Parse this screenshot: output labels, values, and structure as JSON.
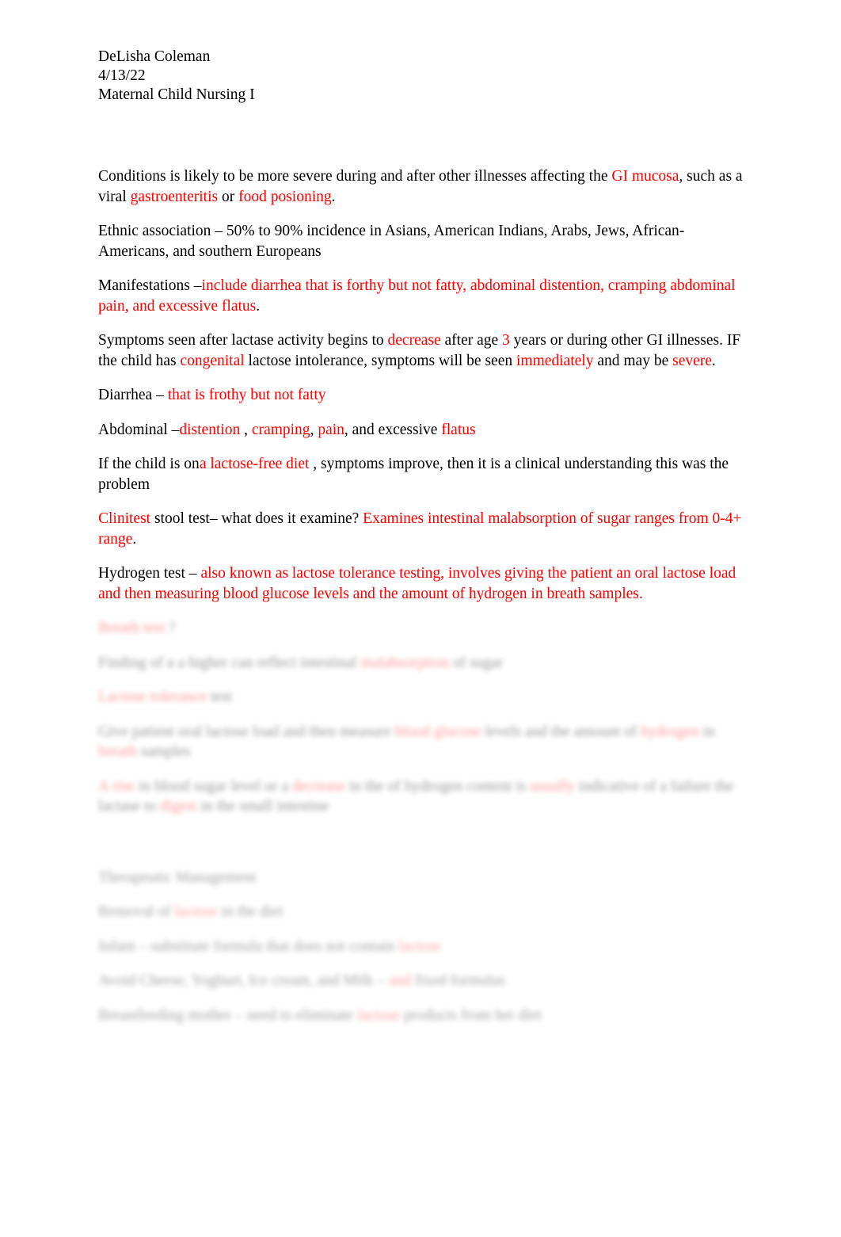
{
  "document": {
    "header": {
      "author": "DeLisha Coleman",
      "date": "4/13/22",
      "course": "Maternal Child Nursing I"
    },
    "colors": {
      "accent_red": "#ff0000",
      "body_black": "#000000",
      "page_background": "#ffffff"
    },
    "paragraphs": [
      {
        "id": "conditions",
        "runs": [
          {
            "text": "Conditions is likely to be more severe during and after other illnesses affecting the  ",
            "color": "black"
          },
          {
            "text": "GI mucosa",
            "color": "red"
          },
          {
            "text": ", such as a viral ",
            "color": "black"
          },
          {
            "text": "gastroenteritis",
            "color": "red"
          },
          {
            "text": "  or  ",
            "color": "black"
          },
          {
            "text": "food posioning",
            "color": "red"
          },
          {
            "text": ".",
            "color": "black"
          }
        ]
      },
      {
        "id": "ethnic-association",
        "runs": [
          {
            "text": "Ethnic association – 50% to 90% incidence in Asians, American Indians, Arabs, Jews, African-Americans, and southern Europeans",
            "color": "black"
          }
        ]
      },
      {
        "id": "manifestations",
        "runs": [
          {
            "text": "Manifestations –",
            "color": "black"
          },
          {
            "text": "include diarrhea that is forthy but not fatty, abdominal distention, cramping abdominal pain, and excessive flatus",
            "color": "red"
          },
          {
            "text": ".",
            "color": "black"
          }
        ]
      },
      {
        "id": "symptoms-onset",
        "runs": [
          {
            "text": "Symptoms seen after lactase activity begins to  ",
            "color": "black"
          },
          {
            "text": "decrease",
            "color": "red"
          },
          {
            "text": "  after age  ",
            "color": "black"
          },
          {
            "text": "3",
            "color": "red"
          },
          {
            "text": " years or during other GI illnesses.  IF the child has ",
            "color": "black"
          },
          {
            "text": "congenital",
            "color": "red"
          },
          {
            "text": "  lactose intolerance, symptoms will be seen  ",
            "color": "black"
          },
          {
            "text": "immediately",
            "color": "red"
          },
          {
            "text": " and may be ",
            "color": "black"
          },
          {
            "text": "severe",
            "color": "red"
          },
          {
            "text": ".",
            "color": "black"
          }
        ]
      },
      {
        "id": "diarrhea",
        "runs": [
          {
            "text": "Diarrhea – ",
            "color": "black"
          },
          {
            "text": "that is frothy but not fatty",
            "color": "red"
          }
        ]
      },
      {
        "id": "abdominal",
        "runs": [
          {
            "text": "Abdominal –",
            "color": "black"
          },
          {
            "text": "distention",
            "color": "red"
          },
          {
            "text": " , ",
            "color": "black"
          },
          {
            "text": "cramping",
            "color": "red"
          },
          {
            "text": ", ",
            "color": "black"
          },
          {
            "text": "pain",
            "color": "red"
          },
          {
            "text": ", and excessive ",
            "color": "black"
          },
          {
            "text": "flatus",
            "color": "red"
          }
        ]
      },
      {
        "id": "lactose-free-diet",
        "runs": [
          {
            "text": "If the child is on",
            "color": "black"
          },
          {
            "text": "a lactose-free diet",
            "color": "red"
          },
          {
            "text": " , symptoms improve, then it is a clinical understanding this was the problem",
            "color": "black"
          }
        ]
      },
      {
        "id": "clinitest",
        "runs": [
          {
            "text": "Clinitest",
            "color": "red"
          },
          {
            "text": " stool test– what does it examine?  ",
            "color": "black"
          },
          {
            "text": "Examines intestinal malabsorption of sugar  ranges from 0-4+ range",
            "color": "red"
          },
          {
            "text": ".",
            "color": "black"
          }
        ]
      },
      {
        "id": "hydrogen-test",
        "runs": [
          {
            "text": "Hydrogen test – ",
            "color": "black"
          },
          {
            "text": "also known as lactose tolerance testing, involves giving the patient an oral lactose load and then measuring blood glucose levels and the amount of hydrogen in breath samples.",
            "color": "red"
          }
        ]
      }
    ],
    "obscured_section": {
      "note": "remaining lines are visually blurred and illegible in the source image",
      "blocks": [
        {
          "id": "obscured-1",
          "runs": [
            {
              "text": "Breath test",
              "color": "red"
            },
            {
              "text": "  ?",
              "color": "black"
            }
          ]
        },
        {
          "id": "obscured-2",
          "runs": [
            {
              "text": "Finding  of a  a higher can reflect intestinal ",
              "color": "black"
            },
            {
              "text": "malabsorption",
              "color": "red"
            },
            {
              "text": " of sugar",
              "color": "black"
            }
          ]
        },
        {
          "id": "obscured-3",
          "runs": [
            {
              "text": "Lactose tolerance",
              "color": "red"
            },
            {
              "text": " test",
              "color": "black"
            }
          ]
        },
        {
          "id": "obscured-4",
          "runs": [
            {
              "text": "Give patient oral lactose load and then measure  ",
              "color": "black"
            },
            {
              "text": "blood glucose",
              "color": "red"
            },
            {
              "text": " levels and the amount of  ",
              "color": "black"
            },
            {
              "text": "hydrogen",
              "color": "red"
            },
            {
              "text": " in ",
              "color": "black"
            },
            {
              "text": "breath",
              "color": "red"
            },
            {
              "text": " samples",
              "color": "black"
            }
          ]
        },
        {
          "id": "obscured-5",
          "runs": [
            {
              "text": "A rise",
              "color": "red"
            },
            {
              "text": " in blood sugar level or a  ",
              "color": "black"
            },
            {
              "text": "decrease",
              "color": "red"
            },
            {
              "text": " in the of hydrogen content is  ",
              "color": "black"
            },
            {
              "text": "usually",
              "color": "red"
            },
            {
              "text": " indicative of a failure  the lactase to  ",
              "color": "black"
            },
            {
              "text": "digest",
              "color": "red"
            },
            {
              "text": "  in the small intestine",
              "color": "black"
            }
          ]
        }
      ],
      "management": {
        "heading": "Therapeutic Management",
        "blocks": [
          {
            "id": "obscured-6",
            "runs": [
              {
                "text": "Removal of ",
                "color": "black"
              },
              {
                "text": "lactose",
                "color": "red"
              },
              {
                "text": " in the diet",
                "color": "black"
              }
            ]
          },
          {
            "id": "obscured-7",
            "runs": [
              {
                "text": "Infant – substitute formula that does not contain  ",
                "color": "black"
              },
              {
                "text": "lactose",
                "color": "red"
              }
            ]
          },
          {
            "id": "obscured-8",
            "runs": [
              {
                "text": "Avoid  Cheese, Yoghurt, Ice cream, and Milk – ",
                "color": "black"
              },
              {
                "text": "and",
                "color": "red"
              },
              {
                "text": " fixed formulas",
                "color": "black"
              }
            ]
          },
          {
            "id": "obscured-9",
            "runs": [
              {
                "text": "Breastfeeding mother – need to eliminate  ",
                "color": "black"
              },
              {
                "text": "lactose",
                "color": "red"
              },
              {
                "text": " products from her diet",
                "color": "black"
              }
            ]
          }
        ]
      }
    }
  }
}
